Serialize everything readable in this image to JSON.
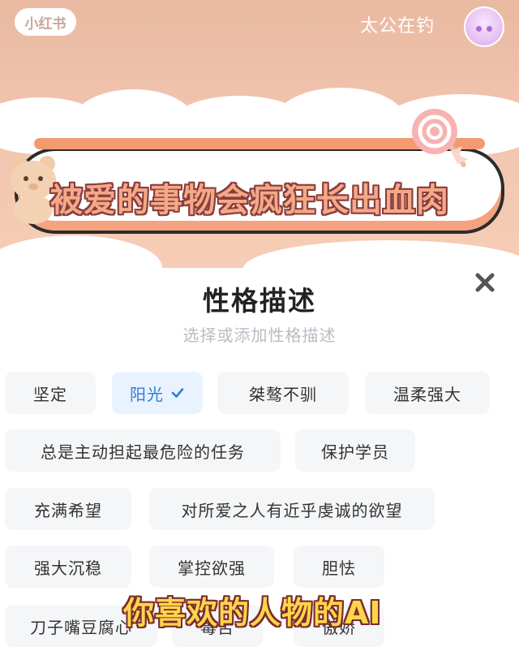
{
  "header": {
    "logo_text": "小红书",
    "user_name": "太公在钓"
  },
  "banner": {
    "title": "被爱的事物会疯狂长出血肉"
  },
  "panel": {
    "title": "性格描述",
    "subtitle": "选择或添加性格描述",
    "selected_color": "#2f7bd8",
    "chips": [
      {
        "label": "坚定",
        "selected": false
      },
      {
        "label": "阳光",
        "selected": true
      },
      {
        "label": "桀骜不驯",
        "selected": false
      },
      {
        "label": "温柔强大",
        "selected": false
      },
      {
        "label": "总是主动担起最危险的任务",
        "selected": false
      },
      {
        "label": "保护学员",
        "selected": false
      },
      {
        "label": "充满希望",
        "selected": false
      },
      {
        "label": "对所爱之人有近乎虔诚的欲望",
        "selected": false
      },
      {
        "label": "强大沉稳",
        "selected": false
      },
      {
        "label": "掌控欲强",
        "selected": false
      },
      {
        "label": "胆怯",
        "selected": false
      },
      {
        "label": "刀子嘴豆腐心",
        "selected": false
      },
      {
        "label": "毒舌",
        "selected": false
      },
      {
        "label": "傲娇",
        "selected": false
      }
    ]
  },
  "caption": "你喜欢的人物的AI"
}
